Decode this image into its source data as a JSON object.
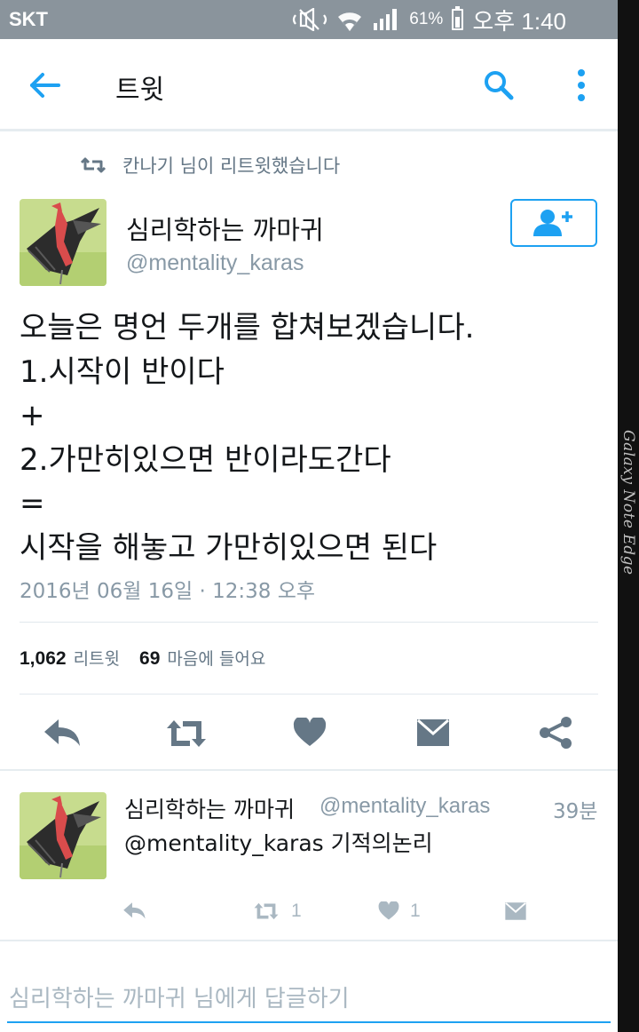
{
  "status_bar": {
    "carrier": "SKT",
    "battery_percent": "61%",
    "time": "오후 1:40",
    "icons": [
      "mute-icon",
      "wifi-icon",
      "signal-icon",
      "battery-icon"
    ]
  },
  "edge_panel": {
    "text": "Galaxy Note Edge"
  },
  "header": {
    "title": "트윗",
    "icons": [
      "back-arrow-icon",
      "search-icon",
      "more-vertical-icon"
    ],
    "accent_color": "#1da1f2"
  },
  "tweet": {
    "retweeted_by": "칸나기 님이 리트윗했습니다",
    "author_name": "심리학하는 까마귀",
    "author_handle": "@mentality_karas",
    "text_lines": [
      "오늘은 명언 두개를 합쳐보겠습니다.",
      "1.시작이 반이다",
      "+",
      "2.가만히있으면 반이라도간다",
      "=",
      "시작을 해놓고 가만히있으면 된다"
    ],
    "timestamp": "2016년 06월 16일 · 12:38 오후",
    "retweet_count": "1,062",
    "retweet_label": "리트윗",
    "like_count": "69",
    "like_label": "마음에 들어요",
    "actions": [
      "reply-icon",
      "retweet-icon",
      "heart-icon",
      "direct-message-icon",
      "share-icon"
    ]
  },
  "reply": {
    "author_name": "심리학하는 까마귀",
    "author_handle": "@mentality_karas",
    "time": "39분",
    "text": "@mentality_karas 기적의논리",
    "retweet_count": "1",
    "like_count": "1"
  },
  "composer": {
    "placeholder": "심리학하는 까마귀 님에게 답글하기"
  }
}
